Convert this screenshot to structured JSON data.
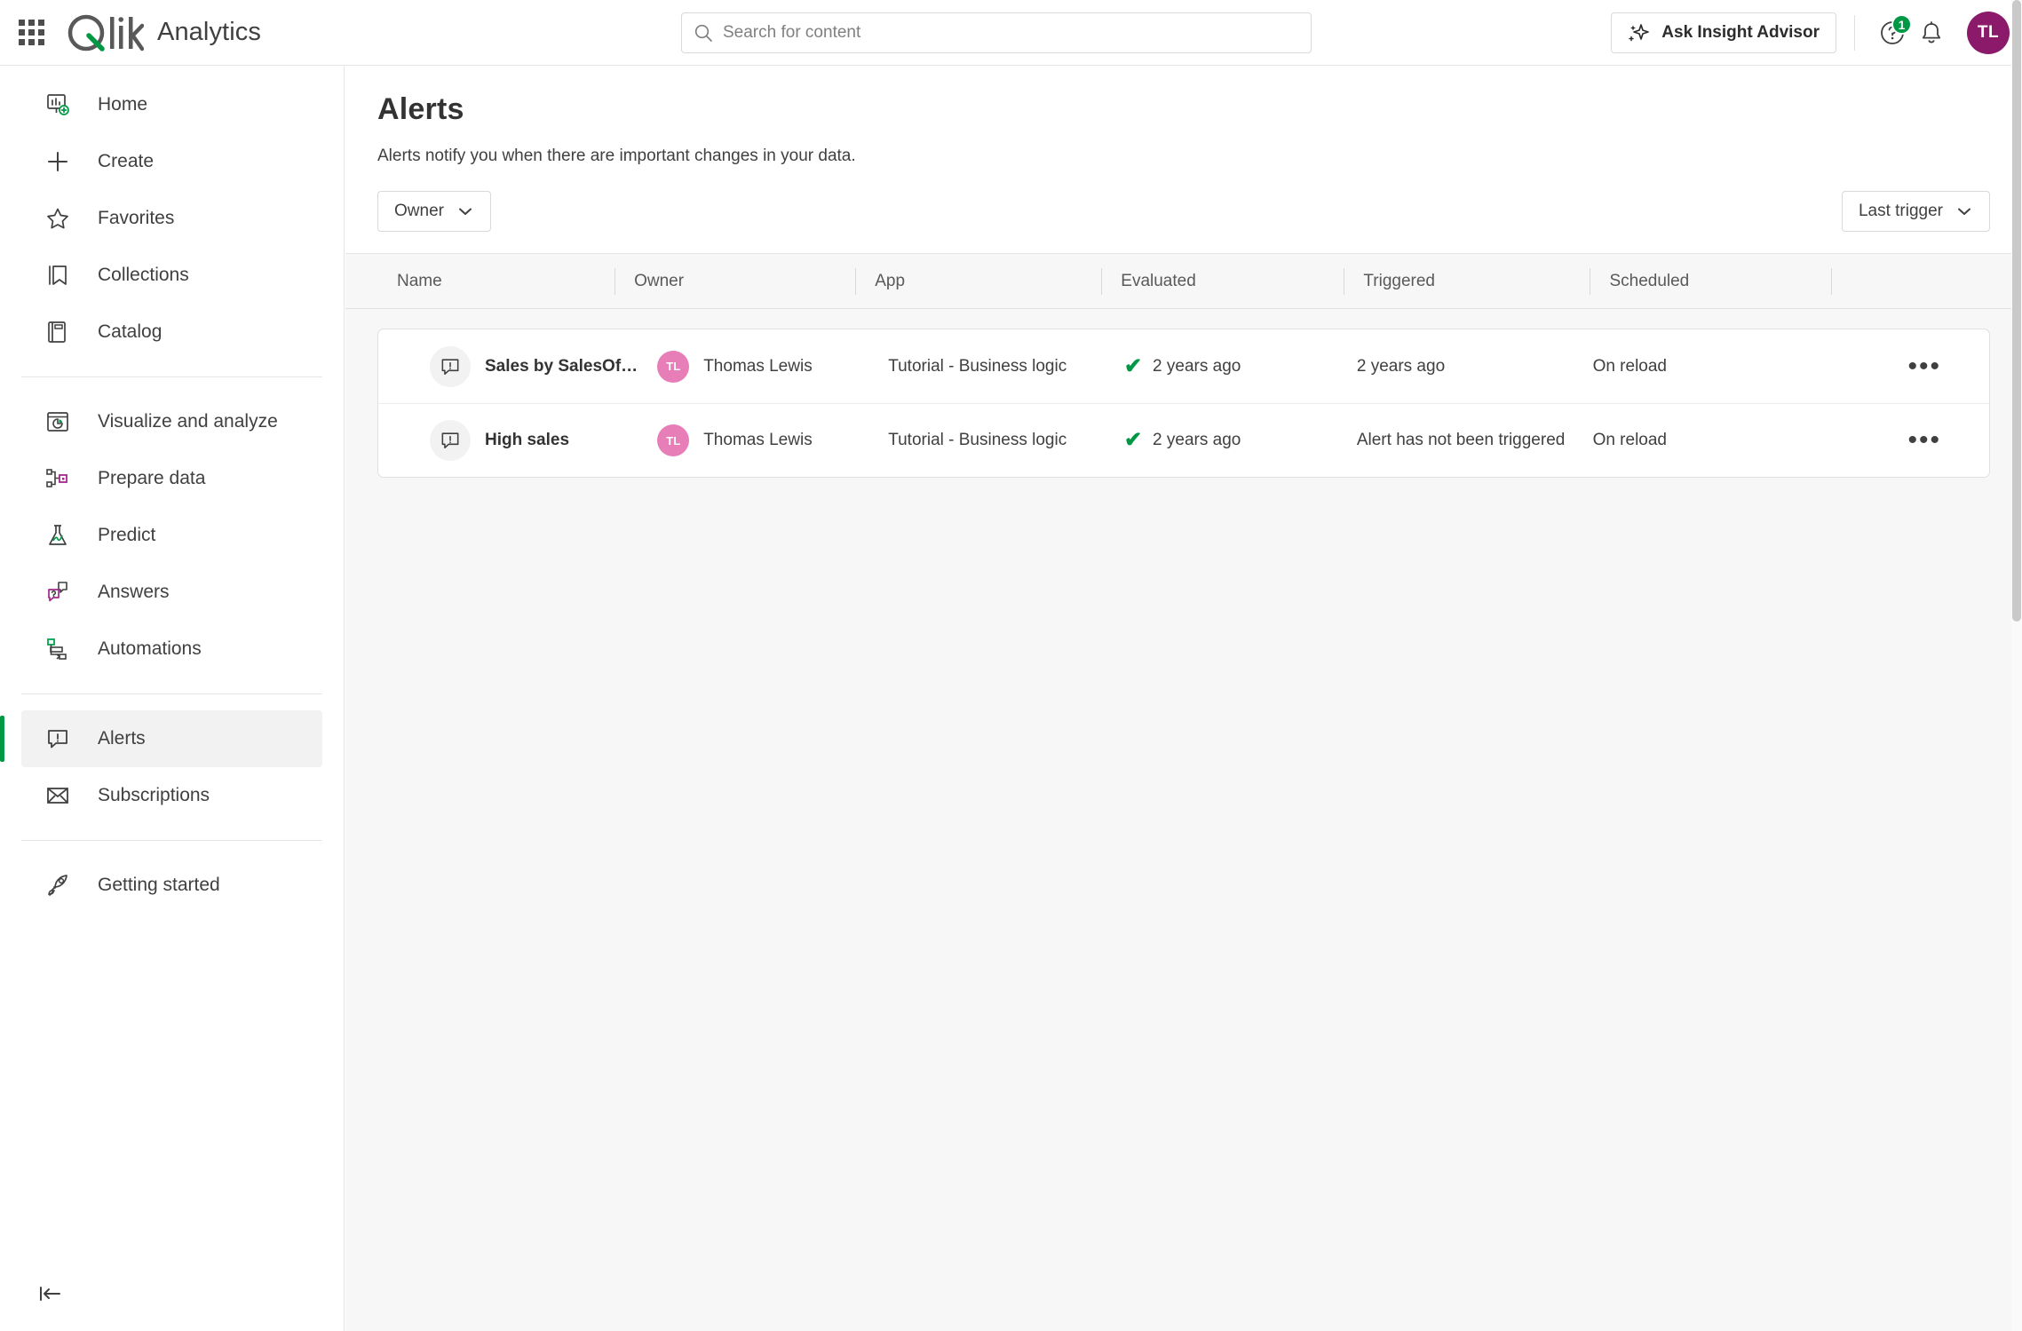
{
  "header": {
    "waffle_icon": "app-grid-icon",
    "logo_text": "Qlik",
    "product_name": "Analytics",
    "search": {
      "placeholder": "Search for content",
      "value": "",
      "icon": "search-icon"
    },
    "insight_advisor_label": "Ask Insight Advisor",
    "insight_advisor_icon": "sparkle-icon",
    "help_icon": "help-circle-icon",
    "help_badge_count": "1",
    "notifications_icon": "bell-icon",
    "avatar_initials": "TL"
  },
  "sidebar": {
    "groups": [
      {
        "items": [
          {
            "label": "Home",
            "icon": "home-dashboard-icon",
            "active": false
          },
          {
            "label": "Create",
            "icon": "plus-icon",
            "active": false
          },
          {
            "label": "Favorites",
            "icon": "star-icon",
            "active": false
          },
          {
            "label": "Collections",
            "icon": "bookmark-icon",
            "active": false
          },
          {
            "label": "Catalog",
            "icon": "book-icon",
            "active": false
          }
        ]
      },
      {
        "items": [
          {
            "label": "Visualize and analyze",
            "icon": "chart-window-icon",
            "active": false
          },
          {
            "label": "Prepare data",
            "icon": "data-nodes-icon",
            "active": false
          },
          {
            "label": "Predict",
            "icon": "flask-icon",
            "active": false
          },
          {
            "label": "Answers",
            "icon": "chat-question-icon",
            "active": false
          },
          {
            "label": "Automations",
            "icon": "automation-flow-icon",
            "active": false
          }
        ]
      },
      {
        "items": [
          {
            "label": "Alerts",
            "icon": "alert-bubble-icon",
            "active": true
          },
          {
            "label": "Subscriptions",
            "icon": "envelope-icon",
            "active": false
          }
        ]
      },
      {
        "items": [
          {
            "label": "Getting started",
            "icon": "rocket-icon",
            "active": false
          }
        ]
      }
    ],
    "collapse_icon": "collapse-left-icon"
  },
  "page": {
    "title": "Alerts",
    "subtitle": "Alerts notify you when there are important changes in your data.",
    "owner_filter_label": "Owner",
    "owner_filter_icon": "chevron-down-icon",
    "sort_label": "Last trigger",
    "sort_icon": "chevron-down-icon"
  },
  "table": {
    "columns": [
      "Name",
      "Owner",
      "App",
      "Evaluated",
      "Triggered",
      "Scheduled",
      ""
    ],
    "rows": [
      {
        "icon": "alert-bubble-icon",
        "name": "Sales by SalesOff…",
        "owner_initials": "TL",
        "owner": "Thomas Lewis",
        "app": "Tutorial - Business logic",
        "evaluated_status_icon": "check-icon",
        "evaluated": "2 years ago",
        "triggered": "2 years ago",
        "scheduled": "On reload",
        "actions_icon": "more-horizontal-icon",
        "actions_label": "•••"
      },
      {
        "icon": "alert-bubble-icon",
        "name": "High sales",
        "owner_initials": "TL",
        "owner": "Thomas Lewis",
        "app": "Tutorial - Business logic",
        "evaluated_status_icon": "check-icon",
        "evaluated": "2 years ago",
        "triggered": "Alert has not been triggered",
        "scheduled": "On reload",
        "actions_icon": "more-horizontal-icon",
        "actions_label": "•••"
      }
    ]
  },
  "colors": {
    "brand_green": "#009845",
    "avatar_purple": "#8b1a6b",
    "avatar_pink": "#e87eb8",
    "accent_magenta": "#a0288c",
    "text_primary": "#404040",
    "surface_gray": "#f7f7f7"
  }
}
